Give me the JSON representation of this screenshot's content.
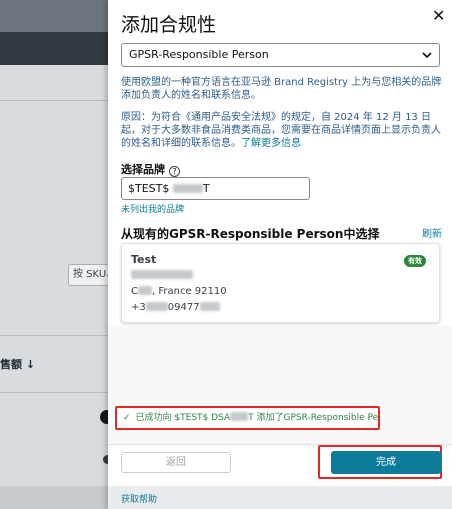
{
  "background": {
    "search_placeholder": "按 SKU、",
    "column_header": "售额 ↓"
  },
  "drawer": {
    "title": "添加合规性",
    "close_icon": "close-icon",
    "compliance_select": {
      "selected": "GPSR-Responsible Person"
    },
    "intro_text": "使用欧盟的一种官方语言在亚马逊 Brand Registry 上为与您相关的品牌添加负责人的姓名和联系信息。",
    "reason_text": "原因：为符合《通用产品安全法规》的规定，自 2024 年 12 月 13 日起，对于大多数非食品消费类商品，您需要在商品详情页面上显示负责人的姓名和详细的联系信息。",
    "learn_more": "了解更多信息",
    "brand_label": "选择品牌",
    "brand_value": "$TEST$ ",
    "brand_value_tail": "T",
    "brand_not_listed": "未列出我的品牌",
    "section_title": "从现有的GPSR-Responsible Person中选择",
    "refresh": "刷新",
    "card": {
      "name": "Test",
      "badge": "有效",
      "address_line_city_prefix": "C",
      "address_line_city": ", France 92110",
      "phone_prefix": "+3",
      "phone_mid": "09477"
    },
    "success_prefix": "已成功向 $TEST$ ",
    "success_mid": "DSA",
    "success_mid2": "T",
    "success_suffix": "添加了GPSR-Responsible Person。",
    "back_button": "返回",
    "done_button": "完成",
    "help_link": "获取帮助"
  },
  "colors": {
    "accent": "#0a7b99",
    "success": "#2e8540",
    "highlight": "#e22b28"
  }
}
